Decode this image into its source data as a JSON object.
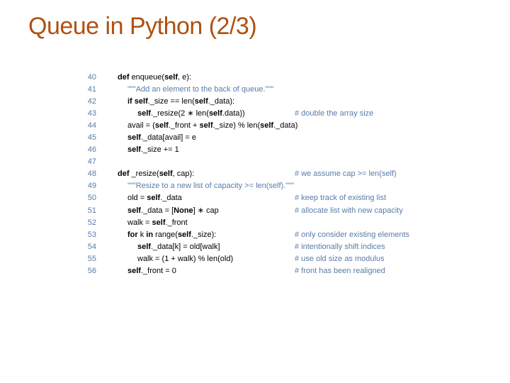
{
  "title": "Queue in Python (2/3)",
  "code": {
    "lines": [
      {
        "n": "40",
        "indent": 0,
        "parts": [
          {
            "t": "def ",
            "b": true
          },
          {
            "t": "enqueue("
          },
          {
            "t": "self",
            "b": true
          },
          {
            "t": ", e):"
          }
        ],
        "comment": ""
      },
      {
        "n": "41",
        "indent": 1,
        "parts": [
          {
            "t": "\"\"\"Add an element to the back of queue.\"\"\"",
            "doc": true
          }
        ],
        "comment": ""
      },
      {
        "n": "42",
        "indent": 1,
        "parts": [
          {
            "t": "if self",
            "b": true
          },
          {
            "t": "._size == len("
          },
          {
            "t": "self",
            "b": true
          },
          {
            "t": "._data):"
          }
        ],
        "comment": ""
      },
      {
        "n": "43",
        "indent": 2,
        "parts": [
          {
            "t": "self",
            "b": true
          },
          {
            "t": "._resize(2 ∗ len("
          },
          {
            "t": "self",
            "b": true
          },
          {
            "t": ".data))"
          }
        ],
        "comment": "# double the array size"
      },
      {
        "n": "44",
        "indent": 1,
        "parts": [
          {
            "t": "avail = ("
          },
          {
            "t": "self",
            "b": true
          },
          {
            "t": "._front + "
          },
          {
            "t": "self",
            "b": true
          },
          {
            "t": "._size) % len("
          },
          {
            "t": "self",
            "b": true
          },
          {
            "t": "._data)"
          }
        ],
        "comment": ""
      },
      {
        "n": "45",
        "indent": 1,
        "parts": [
          {
            "t": "self",
            "b": true
          },
          {
            "t": "._data[avail] = e"
          }
        ],
        "comment": ""
      },
      {
        "n": "46",
        "indent": 1,
        "parts": [
          {
            "t": "self",
            "b": true
          },
          {
            "t": "._size += 1"
          }
        ],
        "comment": ""
      },
      {
        "n": "47",
        "indent": 0,
        "parts": [],
        "comment": ""
      },
      {
        "n": "48",
        "indent": 0,
        "parts": [
          {
            "t": "def ",
            "b": true
          },
          {
            "t": "_resize("
          },
          {
            "t": "self",
            "b": true
          },
          {
            "t": ", cap):"
          }
        ],
        "comment": "# we assume cap >= len(self)"
      },
      {
        "n": "49",
        "indent": 1,
        "parts": [
          {
            "t": "\"\"\"Resize to a new list of capacity >= len(self).\"\"\"",
            "doc": true
          }
        ],
        "comment": ""
      },
      {
        "n": "50",
        "indent": 1,
        "parts": [
          {
            "t": "old = "
          },
          {
            "t": "self",
            "b": true
          },
          {
            "t": "._data"
          }
        ],
        "comment": "# keep track of existing list"
      },
      {
        "n": "51",
        "indent": 1,
        "parts": [
          {
            "t": "self",
            "b": true
          },
          {
            "t": "._data = ["
          },
          {
            "t": "None",
            "b": true
          },
          {
            "t": "] ∗ cap"
          }
        ],
        "comment": "# allocate list with new capacity"
      },
      {
        "n": "52",
        "indent": 1,
        "parts": [
          {
            "t": "walk = "
          },
          {
            "t": "self",
            "b": true
          },
          {
            "t": "._front"
          }
        ],
        "comment": ""
      },
      {
        "n": "53",
        "indent": 1,
        "parts": [
          {
            "t": "for ",
            "b": true
          },
          {
            "t": "k "
          },
          {
            "t": "in ",
            "b": true
          },
          {
            "t": "range("
          },
          {
            "t": "self",
            "b": true
          },
          {
            "t": "._size):"
          }
        ],
        "comment": "# only consider existing elements"
      },
      {
        "n": "54",
        "indent": 2,
        "parts": [
          {
            "t": "self",
            "b": true
          },
          {
            "t": "._data[k] = old[walk]"
          }
        ],
        "comment": "# intentionally shift indices"
      },
      {
        "n": "55",
        "indent": 2,
        "parts": [
          {
            "t": "walk = (1 + walk) % len(old)"
          }
        ],
        "comment": "# use old size as modulus"
      },
      {
        "n": "56",
        "indent": 1,
        "parts": [
          {
            "t": "self",
            "b": true
          },
          {
            "t": "._front = 0"
          }
        ],
        "comment": "# front has been realigned"
      }
    ]
  },
  "layout": {
    "code_col_width": 280
  }
}
